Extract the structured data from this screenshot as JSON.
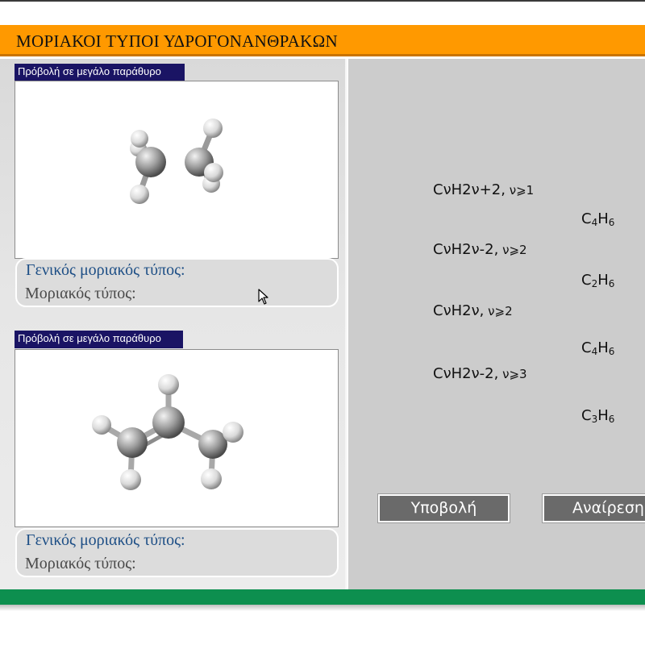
{
  "header": {
    "title": "ΜΟΡΙΑΚΟΙ ΤΥΠΟΙ ΥΔΡΟΓΟΝΑΝΘΡΑΚΩΝ"
  },
  "molecules": [
    {
      "view_large_label": "Πρόβολή σε μεγάλο παράθυρο",
      "general_formula_label": "Γενικός μοριακός τύπος:",
      "molecular_formula_label": "Μοριακός τύπος:"
    },
    {
      "view_large_label": "Πρόβολή σε μεγάλο παράθυρο",
      "general_formula_label": "Γενικός μοριακός τύπος:",
      "molecular_formula_label": "Μοριακός τύπος:"
    }
  ],
  "general_formulas": [
    {
      "body": "CνH2ν+2,",
      "cond": " ν⩾1"
    },
    {
      "body": "CνH2ν-2,",
      "cond": " ν⩾2"
    },
    {
      "body": "CνH2ν,",
      "cond": " ν⩾2"
    },
    {
      "body": "CνH2ν-2,",
      "cond": " ν⩾3"
    }
  ],
  "molecular_formulas": [
    {
      "c": "C",
      "c_sub": "4",
      "h": "H",
      "h_sub": "6"
    },
    {
      "c": "C",
      "c_sub": "2",
      "h": "H",
      "h_sub": "6"
    },
    {
      "c": "C",
      "c_sub": "4",
      "h": "H",
      "h_sub": "6"
    },
    {
      "c": "C",
      "c_sub": "3",
      "h": "H",
      "h_sub": "6"
    }
  ],
  "buttons": {
    "submit_label": "Υποβολή",
    "undo_label": "Αναίρεση"
  },
  "colors": {
    "title_bar": "#ff9900",
    "link_bg": "#1a1464",
    "general_label": "#1e4f86",
    "footer_bar": "#0d8f4f",
    "button_bg": "#6a6a6a"
  },
  "icons": {
    "cursor": "arrow-cursor-icon"
  }
}
